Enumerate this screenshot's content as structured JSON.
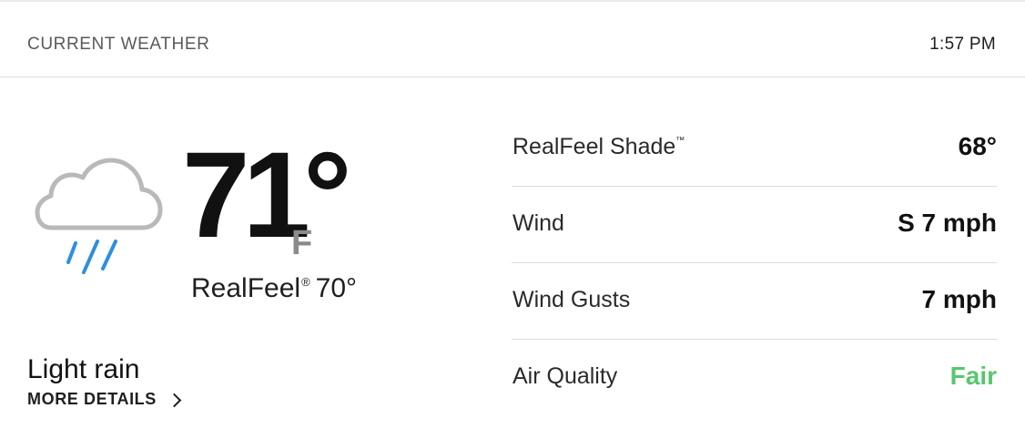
{
  "header": {
    "title": "CURRENT WEATHER",
    "time": "1:57 PM"
  },
  "current": {
    "icon": "rain-cloud-icon",
    "temperature": "71°",
    "unit": "F",
    "realfeel_label": "RealFeel",
    "realfeel_mark": "®",
    "realfeel_value": "70°",
    "phrase": "Light rain",
    "more_details": "MORE DETAILS"
  },
  "details": {
    "realfeel_shade_label": "RealFeel Shade",
    "realfeel_shade_mark": "™",
    "realfeel_shade_value": "68°",
    "wind_label": "Wind",
    "wind_value": "S 7 mph",
    "gusts_label": "Wind Gusts",
    "gusts_value": "7 mph",
    "air_quality_label": "Air Quality",
    "air_quality_value": "Fair"
  },
  "colors": {
    "air_quality_fair": "#57c76f",
    "rain_drop": "#2f8fe0",
    "cloud_outline": "#b9b9b9",
    "unit_gray": "#8b8b8b"
  }
}
